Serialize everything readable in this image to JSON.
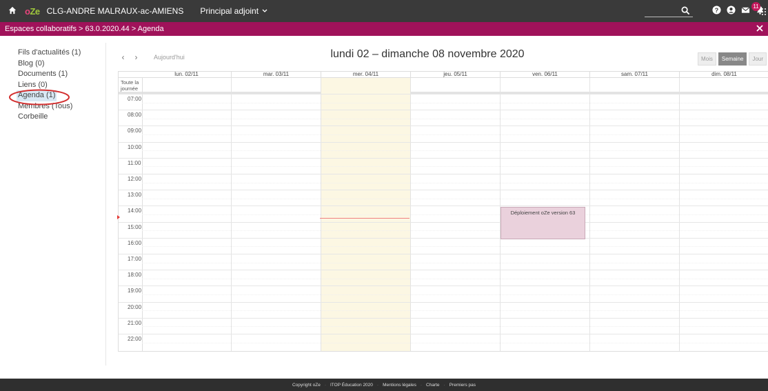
{
  "topbar": {
    "logo_o": "o",
    "logo_ze": "Ze",
    "school": "CLG-ANDRE MALRAUX-ac-AMIENS",
    "role": "Principal adjoint",
    "notifications": "11",
    "bg_color": "#3a3a3a"
  },
  "breadcrumb": {
    "text": "Espaces collaboratifs > 63.0.2020.44 > Agenda",
    "bg_color": "#a0125a"
  },
  "sidebar": {
    "items": [
      {
        "label": "Fils d'actualités (1)"
      },
      {
        "label": "Blog (0)"
      },
      {
        "label": "Documents (1)"
      },
      {
        "label": "Liens (0)"
      },
      {
        "label": "Agenda (1)"
      },
      {
        "label": "Membres (Tous)"
      },
      {
        "label": "Corbeille"
      }
    ],
    "active_index": 4
  },
  "calendar": {
    "prev": "‹",
    "next": "›",
    "today_label": "Aujourd'hui",
    "title": "lundi 02 – dimanche 08 novembre 2020",
    "views": [
      "Mois",
      "Semaine",
      "Jour"
    ],
    "selected_view": "Semaine",
    "allday_label": "Toute la journée",
    "days": [
      "lun. 02/11",
      "mar. 03/11",
      "mer. 04/11",
      "jeu. 05/11",
      "ven. 06/11",
      "sam. 07/11",
      "dim. 08/11"
    ],
    "today_day": "mer. 04/11",
    "hours": [
      "07:00",
      "08:00",
      "09:00",
      "10:00",
      "11:00",
      "12:00",
      "13:00",
      "14:00",
      "15:00",
      "16:00",
      "17:00",
      "18:00",
      "19:00",
      "20:00",
      "21:00",
      "22:00"
    ],
    "events": [
      {
        "title": "Déploiement oZe version 63",
        "day": "ven. 06/11",
        "start": "14:00",
        "end": "16:00",
        "color": "#ead1dc"
      }
    ]
  },
  "footer": {
    "links": [
      "Copyright oZe",
      "ITOP Éducation 2020",
      "Mentions légales",
      "Charte",
      "Premiers pas"
    ]
  }
}
